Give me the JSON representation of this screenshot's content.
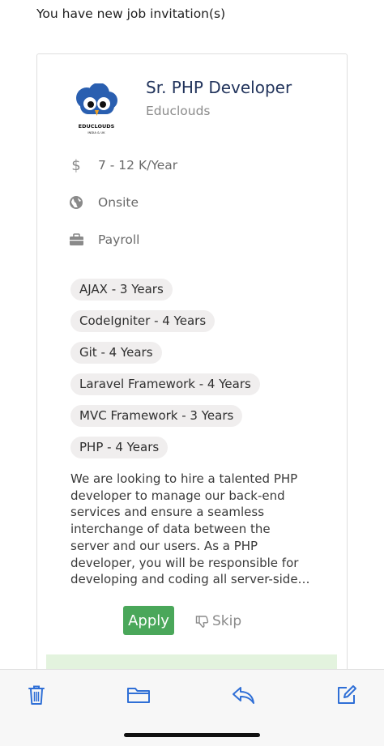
{
  "header": {
    "text": "You have new job invitation(s)"
  },
  "job": {
    "title": "Sr. PHP Developer",
    "company": "Educlouds",
    "logo_text": "EDUCLOUDS",
    "logo_subtext": "INDIA & UK",
    "salary": "7 - 12 K/Year",
    "location_type": "Onsite",
    "employment_type": "Payroll",
    "skills": [
      "AJAX - 3 Years",
      "CodeIgniter - 4 Years",
      "Git - 4 Years",
      "Laravel Framework - 4 Years",
      "MVC Framework - 3 Years",
      "PHP - 4 Years"
    ],
    "description_lines": [
      "We are looking to hire a talented PHP",
      "developer to manage our back-end",
      "services and ensure a seamless",
      "interchange of data between the",
      "server and our users. As a PHP",
      "developer, you will be responsible for",
      "developing and coding all server-side…"
    ]
  },
  "actions": {
    "apply_label": "Apply",
    "skip_label": "Skip"
  },
  "toolbar": {
    "icons": [
      "trash-icon",
      "folder-icon",
      "reply-icon",
      "compose-icon"
    ],
    "accent": "#2f6fd6"
  },
  "colors": {
    "apply": "#4aa75a",
    "title": "#22345c",
    "chip": "#f0eeee"
  }
}
